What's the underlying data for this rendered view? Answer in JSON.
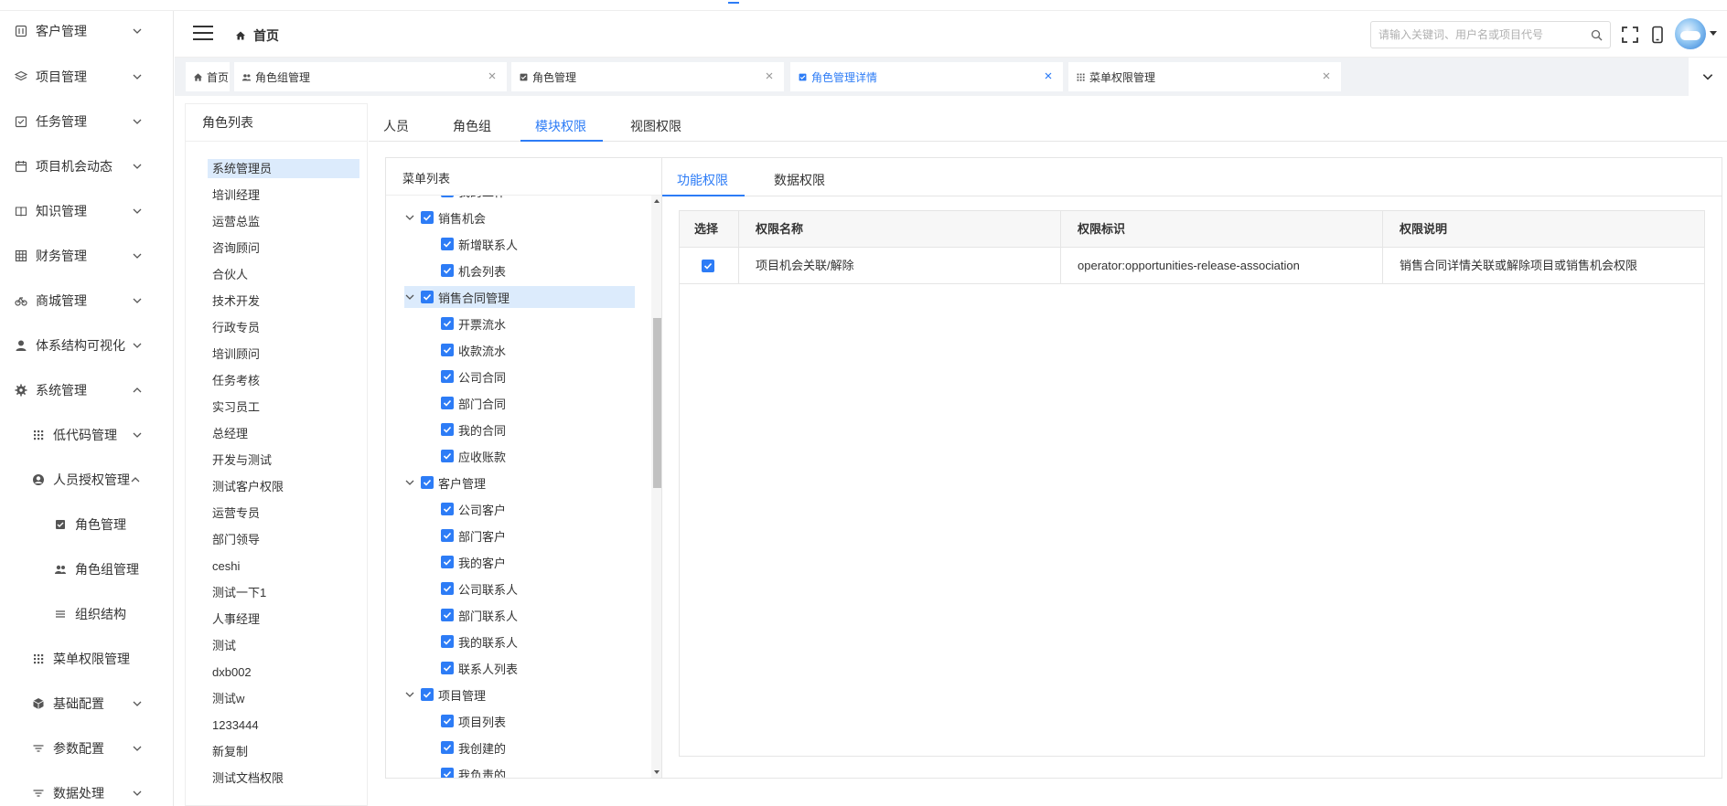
{
  "sidebar": {
    "items": [
      {
        "label": "客户管理",
        "icon": "customer-icon",
        "expanded": false
      },
      {
        "label": "项目管理",
        "icon": "layers-icon",
        "expanded": false
      },
      {
        "label": "任务管理",
        "icon": "task-icon",
        "expanded": false
      },
      {
        "label": "项目机会动态",
        "icon": "calendar-icon",
        "expanded": false
      },
      {
        "label": "知识管理",
        "icon": "book-icon",
        "expanded": false
      },
      {
        "label": "财务管理",
        "icon": "grid-icon",
        "expanded": false
      },
      {
        "label": "商城管理",
        "icon": "bicycle-icon",
        "expanded": false
      },
      {
        "label": "体系结构可视化",
        "icon": "user-icon",
        "expanded": false
      },
      {
        "label": "系统管理",
        "icon": "gear-icon",
        "expanded": true
      },
      {
        "label": "低代码管理",
        "icon": "apps-icon",
        "expanded": false
      },
      {
        "label": "人员授权管理",
        "icon": "account-circle-icon",
        "expanded": true
      },
      {
        "label": "角色管理",
        "icon": "checkbox-icon"
      },
      {
        "label": "角色组管理",
        "icon": "people-icon"
      },
      {
        "label": "组织结构",
        "icon": "list-icon"
      },
      {
        "label": "菜单权限管理",
        "icon": "apps-icon"
      },
      {
        "label": "基础配置",
        "icon": "cube-icon",
        "expanded": false
      },
      {
        "label": "参数配置",
        "icon": "filter-icon",
        "expanded": false
      },
      {
        "label": "数据处理",
        "icon": "filter-icon",
        "expanded": false
      }
    ]
  },
  "header": {
    "breadcrumb": "首页",
    "search_placeholder": "请输入关键词、用户名或项目代号"
  },
  "tabs": [
    {
      "label": "首页",
      "icon": "home-icon",
      "closable": false
    },
    {
      "label": "角色组管理",
      "icon": "people-icon",
      "closable": true
    },
    {
      "label": "角色管理",
      "icon": "checkbox-icon",
      "closable": true
    },
    {
      "label": "角色管理详情",
      "icon": "checkbox-icon",
      "closable": true,
      "active": true
    },
    {
      "label": "菜单权限管理",
      "icon": "apps-icon",
      "closable": true
    }
  ],
  "role_panel": {
    "title": "角色列表",
    "roles": [
      "系统管理员",
      "培训经理",
      "运营总监",
      "咨询顾问",
      "合伙人",
      "技术开发",
      "行政专员",
      "培训顾问",
      "任务考核",
      "实习员工",
      "总经理",
      "开发与测试",
      "测试客户权限",
      "运营专员",
      "部门领导",
      "ceshi",
      "测试一下1",
      "人事经理",
      "测试",
      "dxb002",
      "测试w",
      "1233444",
      "新复制",
      "测试文档权限"
    ],
    "selected": "系统管理员"
  },
  "main_tabs": [
    "人员",
    "角色组",
    "模块权限",
    "视图权限"
  ],
  "main_tab_active": "模块权限",
  "menu_panel": {
    "title": "菜单列表",
    "tree": [
      {
        "label": "我的工作",
        "level": 2,
        "clip": true
      },
      {
        "label": "销售机会",
        "level": 1
      },
      {
        "label": "新增联系人",
        "level": 2
      },
      {
        "label": "机会列表",
        "level": 2
      },
      {
        "label": "销售合同管理",
        "level": 1,
        "highlight": true
      },
      {
        "label": "开票流水",
        "level": 2
      },
      {
        "label": "收款流水",
        "level": 2
      },
      {
        "label": "公司合同",
        "level": 2
      },
      {
        "label": "部门合同",
        "level": 2
      },
      {
        "label": "我的合同",
        "level": 2
      },
      {
        "label": "应收账款",
        "level": 2
      },
      {
        "label": "客户管理",
        "level": 1
      },
      {
        "label": "公司客户",
        "level": 2
      },
      {
        "label": "部门客户",
        "level": 2
      },
      {
        "label": "我的客户",
        "level": 2
      },
      {
        "label": "公司联系人",
        "level": 2
      },
      {
        "label": "部门联系人",
        "level": 2
      },
      {
        "label": "我的联系人",
        "level": 2
      },
      {
        "label": "联系人列表",
        "level": 2
      },
      {
        "label": "项目管理",
        "level": 1
      },
      {
        "label": "项目列表",
        "level": 2
      },
      {
        "label": "我创建的",
        "level": 2
      },
      {
        "label": "我负责的",
        "level": 2
      }
    ]
  },
  "perm_panel": {
    "tabs": [
      "功能权限",
      "数据权限"
    ],
    "active": "功能权限",
    "columns": [
      "选择",
      "权限名称",
      "权限标识",
      "权限说明"
    ],
    "rows": [
      {
        "checked": true,
        "name": "项目机会关联/解除",
        "code": "operator:opportunities-release-association",
        "desc": "销售合同详情关联或解除项目或销售机会权限"
      }
    ]
  },
  "colors": {
    "accent": "#2d7cf6",
    "highlight": "#dcebfc"
  }
}
